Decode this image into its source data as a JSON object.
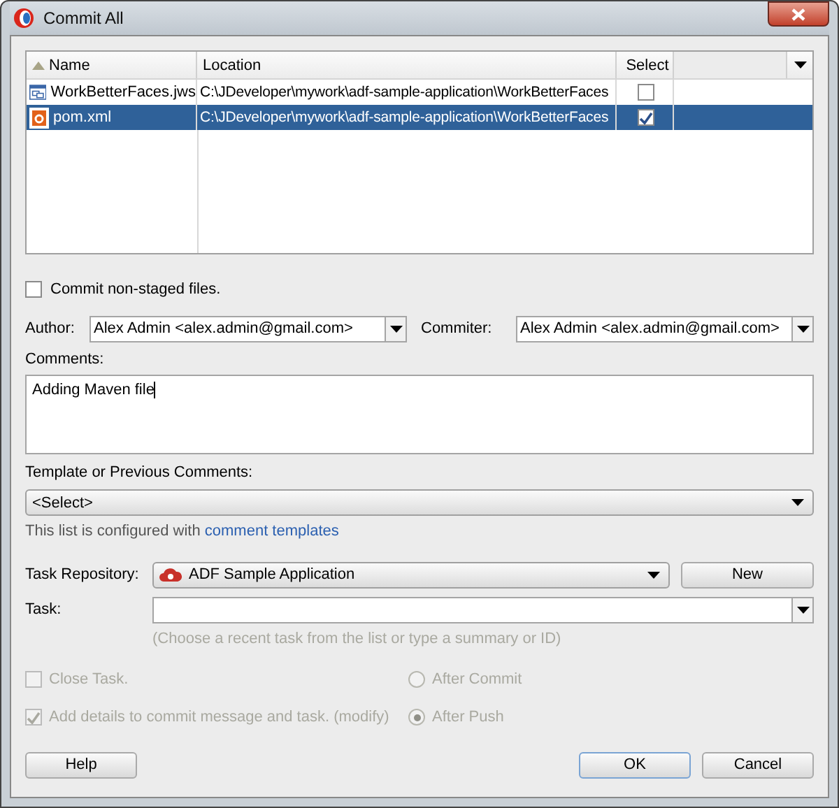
{
  "window": {
    "title": "Commit All"
  },
  "table": {
    "columns": [
      {
        "label": "Name",
        "sorted": true
      },
      {
        "label": "Location",
        "sorted": false
      },
      {
        "label": "Select",
        "sorted": false
      }
    ],
    "rows": [
      {
        "kind": "workspace",
        "name": "WorkBetterFaces.jws",
        "location": "C:\\JDeveloper\\mywork\\adf-sample-application\\WorkBetterFaces",
        "checked": false,
        "selected": false
      },
      {
        "kind": "maven",
        "name": "pom.xml",
        "location": "C:\\JDeveloper\\mywork\\adf-sample-application\\WorkBetterFaces",
        "checked": true,
        "selected": true
      }
    ]
  },
  "commit_non_staged": {
    "label": "Commit non-staged files.",
    "checked": false
  },
  "author": {
    "label": "Author:",
    "value": "Alex Admin <alex.admin@gmail.com>"
  },
  "committer": {
    "label": "Commiter:",
    "value": "Alex Admin <alex.admin@gmail.com>"
  },
  "comments": {
    "label": "Comments:",
    "value": "Adding Maven file"
  },
  "template": {
    "label": "Template or Previous Comments:",
    "value": "<Select>",
    "info": "This list is configured with",
    "link": "comment templates"
  },
  "task_repository": {
    "label": "Task Repository:",
    "value": "ADF Sample Application",
    "new_button": "New"
  },
  "task": {
    "label": "Task:",
    "hint": "(Choose a recent task from the list or type a summary or ID)"
  },
  "close_task": {
    "label": "Close Task.",
    "checked": false,
    "disabled": true
  },
  "add_details": {
    "label": "Add details to commit message and task. (modify)",
    "checked": true,
    "disabled": true
  },
  "timing": [
    {
      "label": "After Commit",
      "selected": false,
      "disabled": true
    },
    {
      "label": "After Push",
      "selected": true,
      "disabled": true
    }
  ],
  "buttons": {
    "help": "Help",
    "ok": "OK",
    "cancel": "Cancel"
  }
}
